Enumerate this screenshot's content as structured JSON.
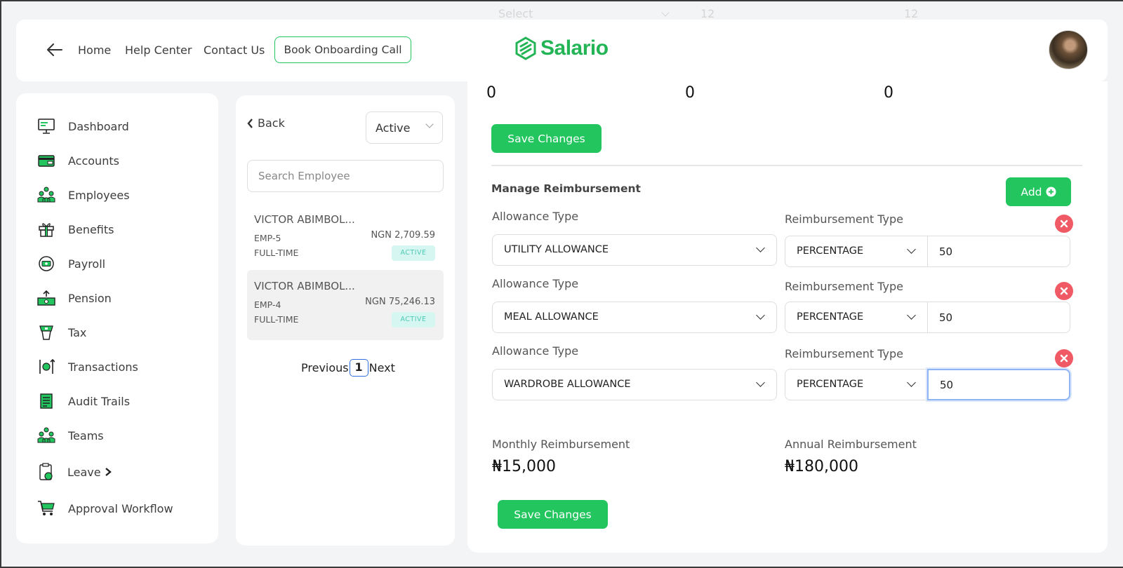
{
  "ghost_row": {
    "select_placeholder": "Select",
    "value_a": "12",
    "value_b": "12"
  },
  "header": {
    "nav": [
      "Home",
      "Help Center",
      "Contact Us"
    ],
    "book_call": "Book Onboarding Call",
    "brand": "Salario",
    "brand_color": "#22b455"
  },
  "sidebar": {
    "items": [
      {
        "label": "Dashboard",
        "icon": "dashboard-icon"
      },
      {
        "label": "Accounts",
        "icon": "wallet-icon"
      },
      {
        "label": "Employees",
        "icon": "people-icon"
      },
      {
        "label": "Benefits",
        "icon": "gift-icon"
      },
      {
        "label": "Payroll",
        "icon": "payroll-cycle-icon"
      },
      {
        "label": "Pension",
        "icon": "pension-icon"
      },
      {
        "label": "Tax",
        "icon": "tax-icon"
      },
      {
        "label": "Transactions",
        "icon": "transactions-icon"
      },
      {
        "label": "Audit Trails",
        "icon": "audit-icon"
      },
      {
        "label": "Teams",
        "icon": "teams-icon"
      },
      {
        "label": "Leave",
        "icon": "leave-icon"
      },
      {
        "label": "Approval Workflow",
        "icon": "cart-icon"
      }
    ]
  },
  "employee_panel": {
    "back": "Back",
    "status_filter": "Active",
    "search_placeholder": "Search Employee",
    "employees": [
      {
        "name": "VICTOR ABIMBOL...",
        "code": "EMP-5",
        "type": "FULL-TIME",
        "pay": "NGN 2,709.59",
        "status": "ACTIVE"
      },
      {
        "name": "VICTOR ABIMBOL...",
        "code": "EMP-4",
        "type": "FULL-TIME",
        "pay": "NGN 75,246.13",
        "status": "ACTIVE"
      }
    ],
    "pagination": {
      "previous": "Previous",
      "current": "1",
      "next": "Next"
    }
  },
  "main": {
    "top_values": [
      "0",
      "0",
      "0"
    ],
    "save_changes": "Save Changes",
    "section_title": "Manage Reimbursement",
    "add": "Add",
    "rows": [
      {
        "allowance_label": "Allowance Type",
        "allowance": "UTILITY ALLOWANCE",
        "reimb_label": "Reimbursement Type",
        "reimb_type": "PERCENTAGE",
        "value": "50"
      },
      {
        "allowance_label": "Allowance Type",
        "allowance": "MEAL ALLOWANCE",
        "reimb_label": "Reimbursement Type",
        "reimb_type": "PERCENTAGE",
        "value": "50"
      },
      {
        "allowance_label": "Allowance Type",
        "allowance": "WARDROBE ALLOWANCE",
        "reimb_label": "Reimbursement Type",
        "reimb_type": "PERCENTAGE",
        "value": "50"
      }
    ],
    "monthly_label": "Monthly Reimbursement",
    "monthly_value": "₦15,000",
    "annual_label": "Annual Reimbursement",
    "annual_value": "₦180,000",
    "accent": "#22c55e",
    "danger": "#f05a64"
  }
}
